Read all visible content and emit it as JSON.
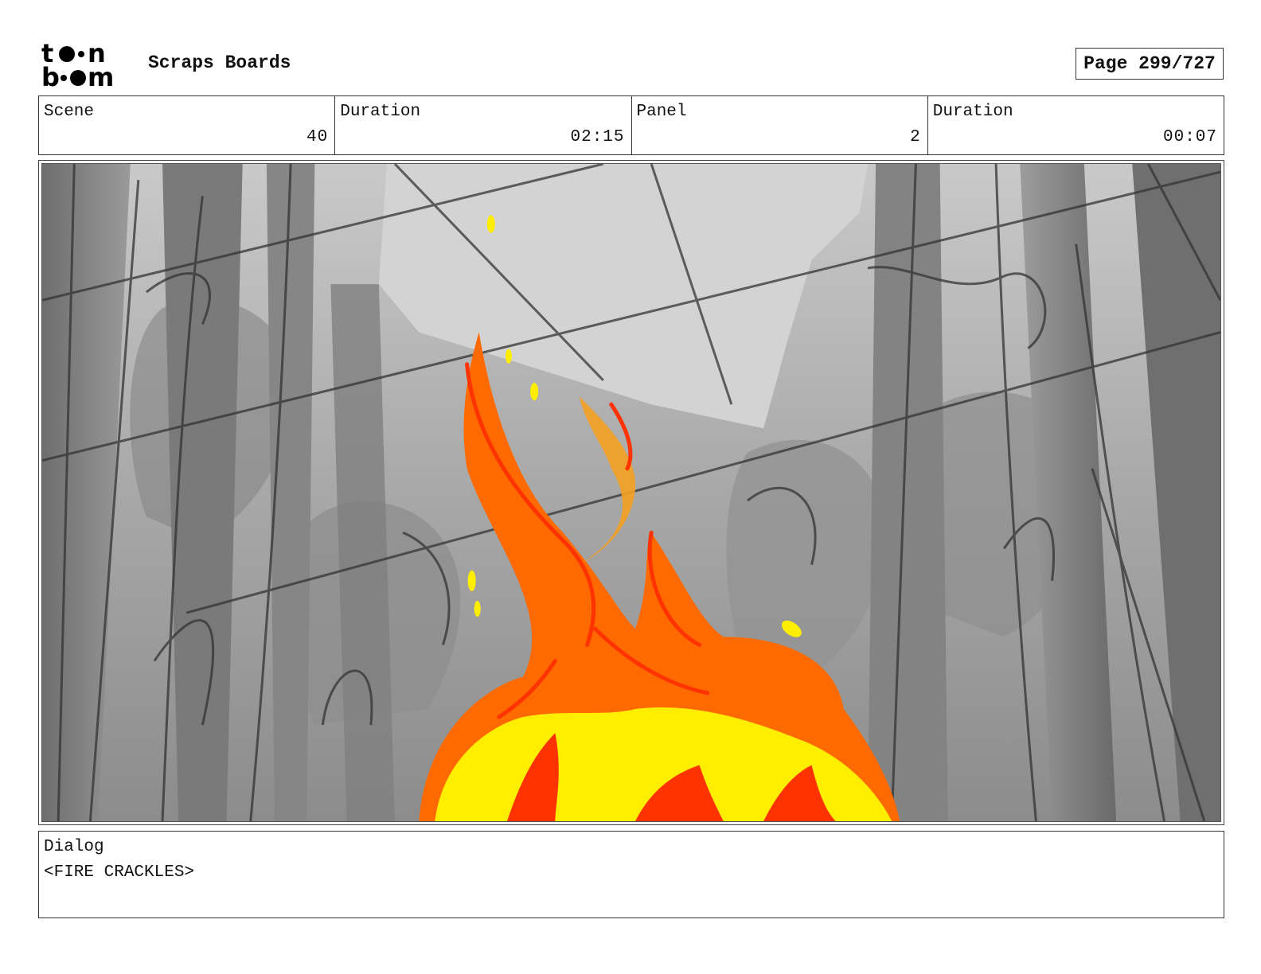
{
  "header": {
    "logo_alt": "toon boom",
    "title": "Scraps Boards",
    "page_indicator": "Page 299/727"
  },
  "info": {
    "scene": {
      "label": "Scene",
      "value": "40"
    },
    "scene_duration": {
      "label": "Duration",
      "value": "02:15"
    },
    "panel": {
      "label": "Panel",
      "value": "2"
    },
    "panel_duration": {
      "label": "Duration",
      "value": "00:07"
    }
  },
  "panel_image": {
    "subject": "forest-fire-sketch",
    "colors": {
      "flame_yellow": "#ffff00",
      "flame_orange": "#ff6a00",
      "flame_red": "#ff3300",
      "sky_gray": "#d2d2d2",
      "tree_gray": "#8a8a8a"
    }
  },
  "dialog": {
    "label": "Dialog",
    "text": "<FIRE CRACKLES>"
  }
}
